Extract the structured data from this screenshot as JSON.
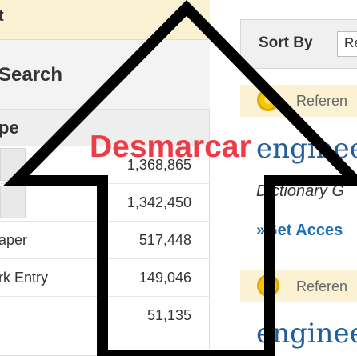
{
  "left_panel": {
    "refine_header": "t",
    "search_heading": "Search",
    "type_header": "pe",
    "rows": [
      {
        "label": "",
        "count": "1,368,865"
      },
      {
        "label": "",
        "count": "1,342,450"
      },
      {
        "label": "aper",
        "count": "517,448"
      },
      {
        "label": "rk Entry",
        "count": "149,046"
      },
      {
        "label": "",
        "count": "51,135"
      }
    ]
  },
  "right_panel": {
    "sort_label": "Sort By",
    "sort_value": "Re",
    "results": [
      {
        "ref_label": "Referen",
        "title": "enginee",
        "subtitle": "Dictionary G",
        "access": "»Get Acces"
      },
      {
        "ref_label": "Referen",
        "title": "enginee"
      }
    ]
  },
  "overlay": {
    "label": "Desmarcar",
    "label_color": "#ef3b45"
  }
}
